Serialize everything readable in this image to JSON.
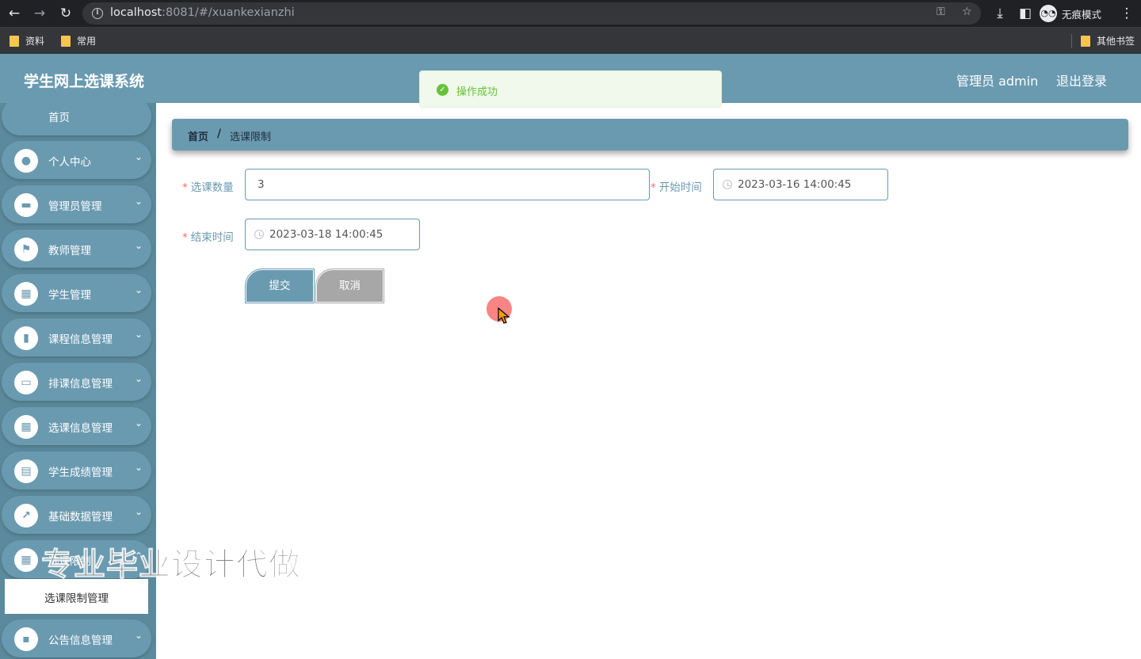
{
  "browser": {
    "url_host": "localhost",
    "url_rest": ":8081/#/xuankexianzhi",
    "incognito_label": "无痕模式",
    "bookmarks": [
      "资料",
      "常用"
    ],
    "other_bookmarks": "其他书签"
  },
  "header": {
    "title": "学生网上选课系统",
    "admin_label": "管理员 admin",
    "logout_label": "退出登录"
  },
  "toast": {
    "message": "操作成功"
  },
  "sidebar": {
    "home": "首页",
    "items": [
      {
        "label": "个人中心",
        "icon": "user-icon"
      },
      {
        "label": "管理员管理",
        "icon": "briefcase-icon"
      },
      {
        "label": "教师管理",
        "icon": "flag-icon"
      },
      {
        "label": "学生管理",
        "icon": "grid-icon"
      },
      {
        "label": "课程信息管理",
        "icon": "book-icon"
      },
      {
        "label": "排课信息管理",
        "icon": "monitor-icon"
      },
      {
        "label": "选课信息管理",
        "icon": "grid-icon"
      },
      {
        "label": "学生成绩管理",
        "icon": "clipboard-icon"
      },
      {
        "label": "基础数据管理",
        "icon": "chart-icon"
      },
      {
        "label": "选课限制",
        "icon": "grid-icon"
      }
    ],
    "active_item": "选课限制管理",
    "last_item": {
      "label": "公告信息管理",
      "icon": "chat-icon"
    }
  },
  "watermark": "专业毕业设计代做",
  "breadcrumb": {
    "home": "首页",
    "separator": "/",
    "current": "选课限制"
  },
  "form": {
    "count_label": "选课数量",
    "count_value": "3",
    "start_label": "开始时间",
    "start_value": "2023-03-16 14:00:45",
    "end_label": "结束时间",
    "end_value": "2023-03-18 14:00:45",
    "submit_label": "提交",
    "cancel_label": "取消"
  }
}
